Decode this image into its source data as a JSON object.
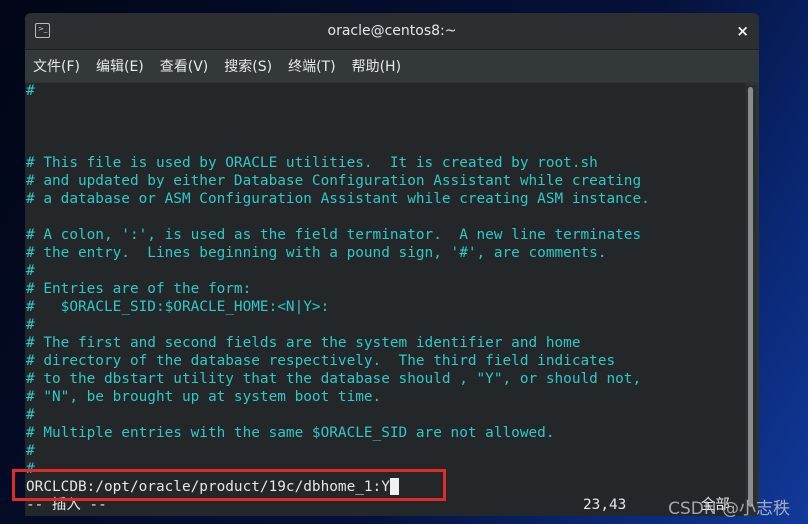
{
  "window": {
    "title": "oracle@centos8:~",
    "icon": "terminal-icon",
    "close": "×"
  },
  "menu": [
    "文件(F)",
    "编辑(E)",
    "查看(V)",
    "搜索(S)",
    "终端(T)",
    "帮助(H)"
  ],
  "lines": [
    "#",
    "",
    "",
    "",
    "# This file is used by ORACLE utilities.  It is created by root.sh",
    "# and updated by either Database Configuration Assistant while creating",
    "# a database or ASM Configuration Assistant while creating ASM instance.",
    "",
    "# A colon, ':', is used as the field terminator.  A new line terminates",
    "# the entry.  Lines beginning with a pound sign, '#', are comments.",
    "#",
    "# Entries are of the form:",
    "#   $ORACLE_SID:$ORACLE_HOME:<N|Y>:",
    "#",
    "# The first and second fields are the system identifier and home",
    "# directory of the database respectively.  The third field indicates",
    "# to the dbstart utility that the database should , \"Y\", or should not,",
    "# \"N\", be brought up at system boot time.",
    "#",
    "# Multiple entries with the same $ORACLE_SID are not allowed.",
    "#",
    "#"
  ],
  "entry": "ORCLCDB:/opt/oracle/product/19c/dbhome_1:Y",
  "status": {
    "mode": "-- 插入 --",
    "position": "23,43",
    "scroll": "全部"
  },
  "watermark": "CSDN @小志秩",
  "colors": {
    "comment": "#2ec8c8",
    "highlight": "#e02b2b"
  }
}
